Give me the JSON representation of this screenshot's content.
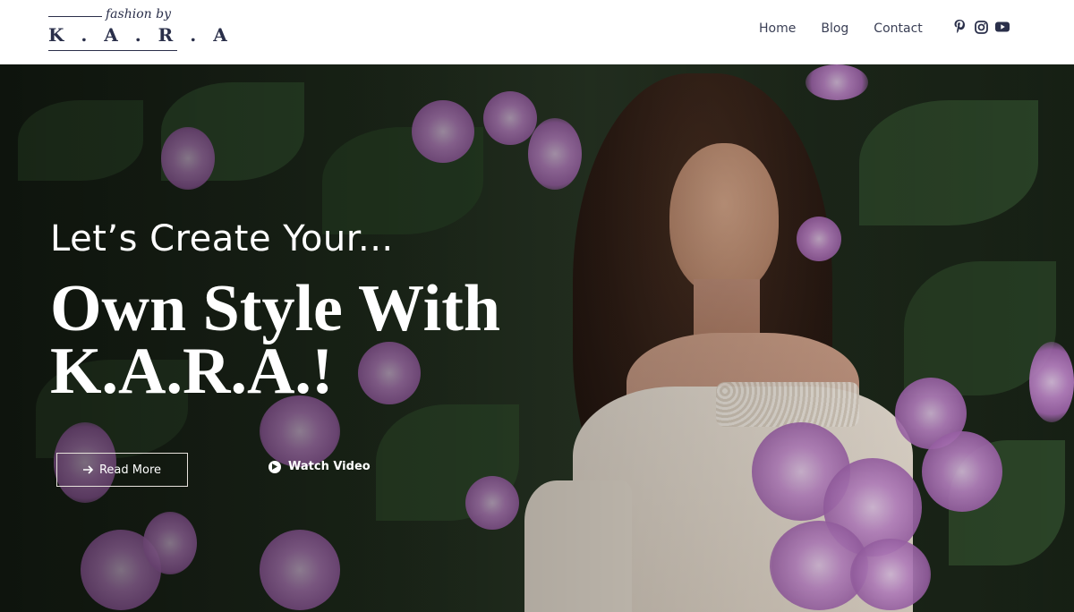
{
  "header": {
    "logo": {
      "tagline": "fashion by",
      "brand": "K . A . R . A"
    },
    "nav": [
      {
        "label": "Home"
      },
      {
        "label": "Blog"
      },
      {
        "label": "Contact"
      }
    ],
    "social_icons": [
      "pinterest-icon",
      "instagram-icon",
      "youtube-icon"
    ]
  },
  "hero": {
    "subtitle": "Let’s Create Your...",
    "title": "Own Style With K.A.R.A.!",
    "read_more_label": "Read More",
    "watch_video_label": "Watch Video"
  },
  "colors": {
    "brand_navy": "#2a2f4a",
    "nav_text": "#3a3f55",
    "hero_text": "#ffffff",
    "accent_flower": "#c58ad0"
  }
}
